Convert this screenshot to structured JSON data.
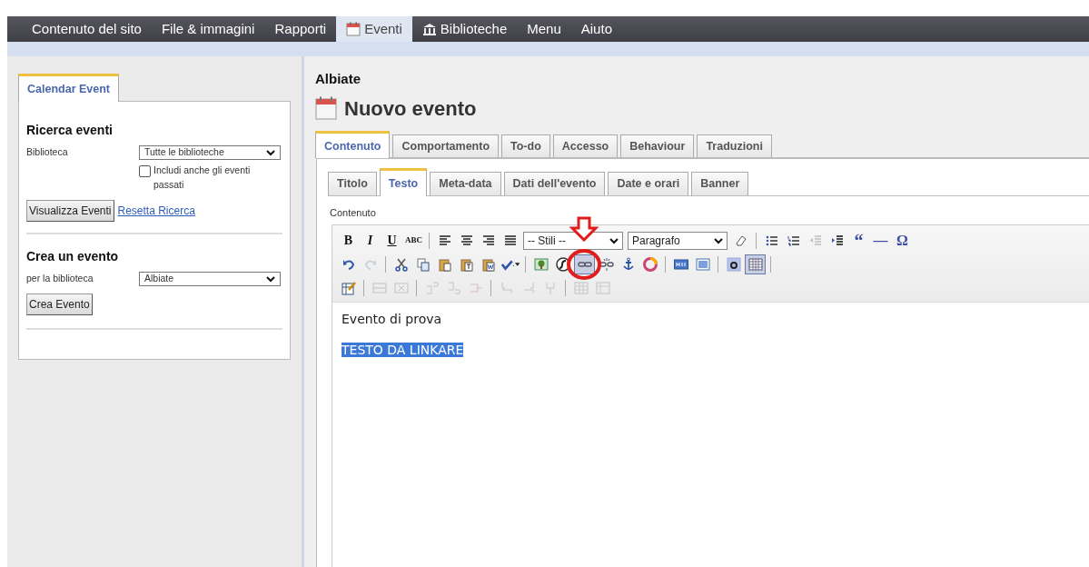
{
  "nav": [
    {
      "label": "Contenuto del sito",
      "kind": "text",
      "selected": false
    },
    {
      "label": "File & immagini",
      "kind": "text",
      "selected": false
    },
    {
      "label": "Rapporti",
      "kind": "text",
      "selected": false
    },
    {
      "label": "Eventi",
      "kind": "calendar",
      "selected": true
    },
    {
      "label": "Biblioteche",
      "kind": "building",
      "selected": false
    },
    {
      "label": "Menu",
      "kind": "text",
      "selected": false
    },
    {
      "label": "Aiuto",
      "kind": "text",
      "selected": false
    }
  ],
  "sidebar": {
    "tabs": [
      {
        "label": "Calendar Event",
        "selected": true
      }
    ],
    "search": {
      "title": "Ricerca eventi",
      "field_label": "Biblioteca",
      "select_value": "Tutte le biblioteche",
      "checkbox": {
        "label": "Includi anche gli eventi passati",
        "checked": false
      },
      "button": "Visualizza Eventi",
      "link": "Resetta Ricerca"
    },
    "create": {
      "title": "Crea un evento",
      "field_label": "per la biblioteca",
      "select_value": "Albiate",
      "button": "Crea Evento"
    }
  },
  "main": {
    "library": "Albiate",
    "title": "Nuovo evento",
    "tabs": [
      {
        "label": "Contenuto",
        "selected": true
      },
      {
        "label": "Comportamento",
        "selected": false
      },
      {
        "label": "To-do",
        "selected": false
      },
      {
        "label": "Accesso",
        "selected": false
      },
      {
        "label": "Behaviour",
        "selected": false
      },
      {
        "label": "Traduzioni",
        "selected": false
      }
    ],
    "subtabs": [
      {
        "label": "Titolo",
        "selected": false
      },
      {
        "label": "Testo",
        "selected": true
      },
      {
        "label": "Meta-data",
        "selected": false
      },
      {
        "label": "Dati dell'evento",
        "selected": false
      },
      {
        "label": "Date e orari",
        "selected": false
      },
      {
        "label": "Banner",
        "selected": false
      }
    ],
    "editor_label": "Contenuto",
    "toolbar": [
      [
        {
          "kind": "glyph",
          "label": "B",
          "disabled": false,
          "selected": false
        },
        {
          "kind": "glyph",
          "label": "I",
          "disabled": false,
          "selected": false
        },
        {
          "kind": "glyph",
          "label": "U",
          "disabled": false,
          "selected": false
        },
        {
          "kind": "glyph",
          "label": "ABC",
          "disabled": false,
          "selected": false
        },
        {
          "kind": "separator"
        },
        {
          "kind": "icon",
          "disabled": false,
          "selected": false
        },
        {
          "kind": "icon",
          "disabled": false,
          "selected": false
        },
        {
          "kind": "icon",
          "disabled": false,
          "selected": false
        },
        {
          "kind": "icon",
          "disabled": false,
          "selected": false
        },
        {
          "kind": "select",
          "label": "-- Stili --"
        },
        {
          "kind": "select",
          "label": "Paragrafo"
        },
        {
          "kind": "icon",
          "disabled": false,
          "selected": false
        },
        {
          "kind": "separator"
        },
        {
          "kind": "icon",
          "disabled": false,
          "selected": false
        },
        {
          "kind": "icon",
          "disabled": false,
          "selected": false
        },
        {
          "kind": "icon",
          "disabled": true,
          "selected": false
        },
        {
          "kind": "icon",
          "disabled": false,
          "selected": false
        },
        {
          "kind": "glyph",
          "label": "“",
          "disabled": false,
          "selected": false
        },
        {
          "kind": "glyph",
          "label": "—",
          "disabled": false,
          "selected": false
        },
        {
          "kind": "glyph",
          "label": "Ω",
          "disabled": false,
          "selected": false
        }
      ],
      [
        {
          "kind": "icon",
          "disabled": false,
          "selected": false
        },
        {
          "kind": "icon",
          "disabled": true,
          "selected": false
        },
        {
          "kind": "separator"
        },
        {
          "kind": "icon",
          "disabled": false,
          "selected": false
        },
        {
          "kind": "icon",
          "disabled": false,
          "selected": false
        },
        {
          "kind": "icon",
          "disabled": false,
          "selected": false
        },
        {
          "kind": "icon",
          "disabled": false,
          "selected": false
        },
        {
          "kind": "icon",
          "disabled": false,
          "selected": false
        },
        {
          "kind": "icon",
          "disabled": false,
          "selected": false
        },
        {
          "kind": "separator"
        },
        {
          "kind": "icon",
          "disabled": false,
          "selected": false
        },
        {
          "kind": "icon",
          "disabled": false,
          "selected": false
        },
        {
          "kind": "icon",
          "disabled": false,
          "selected": true
        },
        {
          "kind": "icon",
          "disabled": false,
          "selected": false
        },
        {
          "kind": "icon",
          "disabled": false,
          "selected": false
        },
        {
          "kind": "icon",
          "disabled": false,
          "selected": false
        },
        {
          "kind": "separator"
        },
        {
          "kind": "icon",
          "disabled": false,
          "selected": false
        },
        {
          "kind": "icon",
          "disabled": false,
          "selected": false
        },
        {
          "kind": "separator"
        },
        {
          "kind": "icon",
          "disabled": false,
          "selected": false
        },
        {
          "kind": "icon",
          "disabled": false,
          "selected": true
        },
        {
          "kind": "separator"
        }
      ],
      [
        {
          "kind": "icon",
          "disabled": false,
          "selected": false
        },
        {
          "kind": "separator"
        },
        {
          "kind": "icon",
          "disabled": true,
          "selected": false
        },
        {
          "kind": "icon",
          "disabled": true,
          "selected": false
        },
        {
          "kind": "separator"
        },
        {
          "kind": "icon",
          "disabled": true,
          "selected": false
        },
        {
          "kind": "icon",
          "disabled": true,
          "selected": false
        },
        {
          "kind": "icon",
          "disabled": true,
          "selected": false
        },
        {
          "kind": "separator"
        },
        {
          "kind": "icon",
          "disabled": true,
          "selected": false
        },
        {
          "kind": "icon",
          "disabled": true,
          "selected": false
        },
        {
          "kind": "icon",
          "disabled": true,
          "selected": false
        },
        {
          "kind": "separator"
        },
        {
          "kind": "icon",
          "disabled": true,
          "selected": false
        },
        {
          "kind": "icon",
          "disabled": true,
          "selected": false
        }
      ]
    ],
    "content": [
      {
        "text": "Evento di prova",
        "selected": false
      },
      {
        "text": "TESTO DA LINKARE",
        "selected": true
      }
    ]
  },
  "annotation": {
    "arrow": true,
    "circle": true
  }
}
